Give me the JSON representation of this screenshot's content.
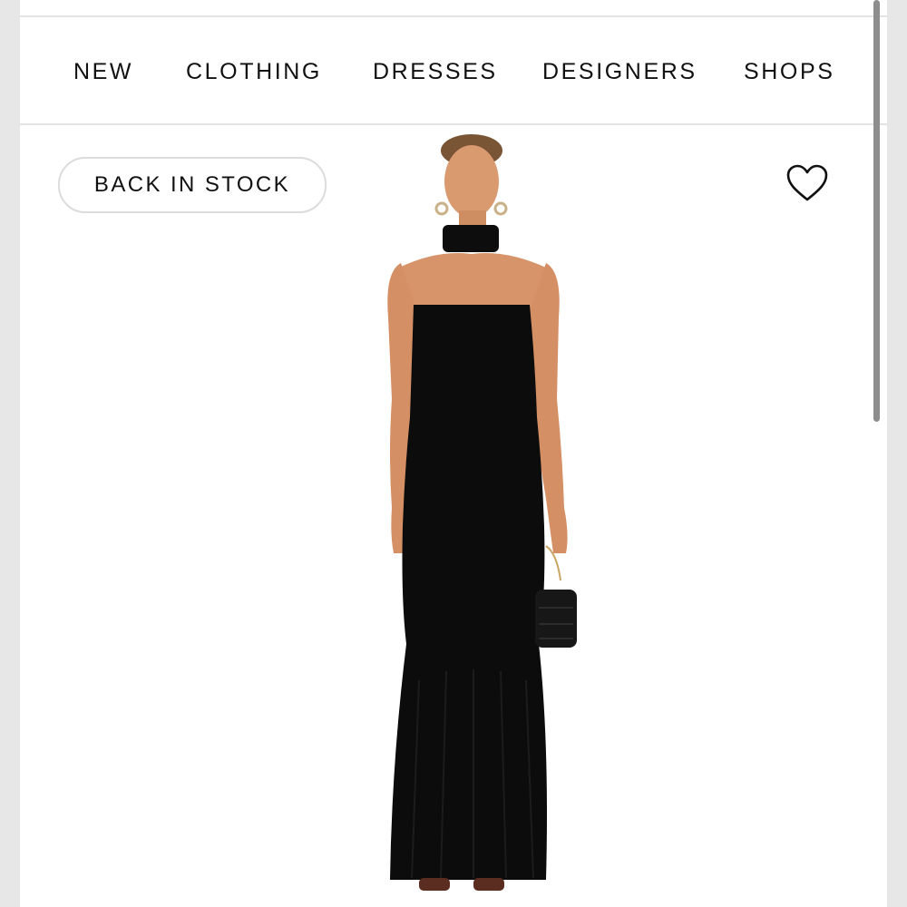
{
  "nav": {
    "items": [
      {
        "label": "NEW"
      },
      {
        "label": "CLOTHING"
      },
      {
        "label": "DRESSES"
      },
      {
        "label": "DESIGNERS"
      },
      {
        "label": "SHOPS"
      }
    ]
  },
  "product": {
    "badge": "BACK IN STOCK",
    "favorite_icon": "heart-outline-icon",
    "image_subject": "model-in-black-strapless-mermaid-gown-with-quilted-mini-bag"
  },
  "colors": {
    "background": "#ffffff",
    "text": "#111111",
    "divider": "#e3e3e3",
    "garment": "#0c0c0c",
    "skin": "#d7946a",
    "scrollbar": "#8d8d8d"
  }
}
